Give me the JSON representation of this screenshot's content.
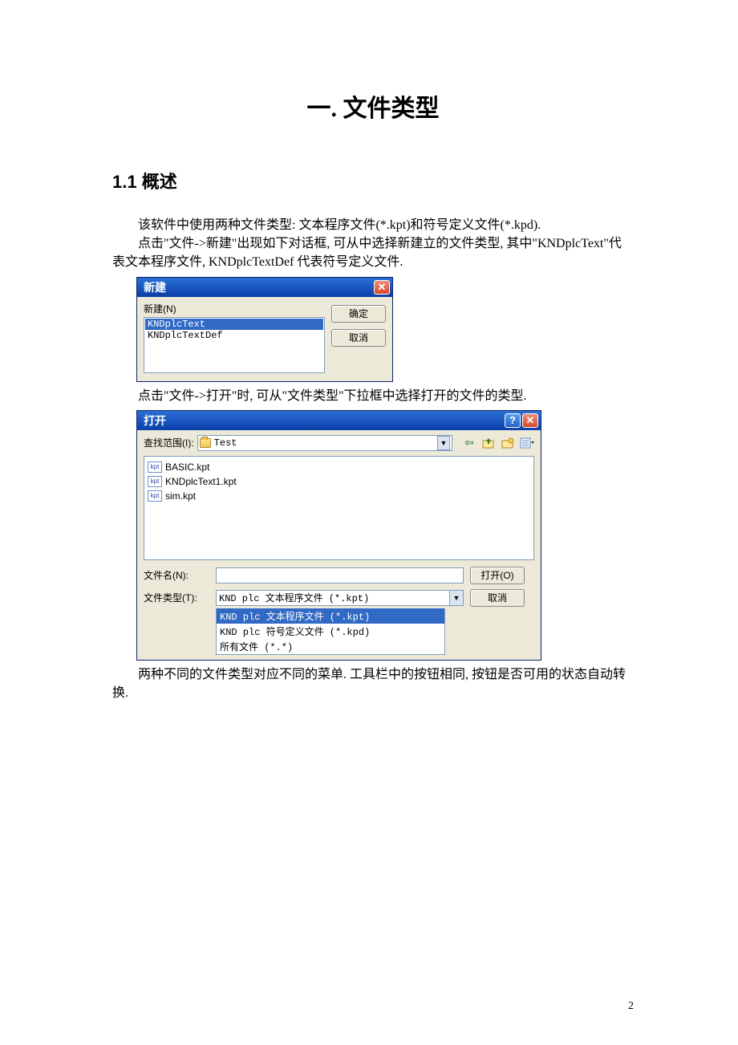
{
  "chapter_title": "一. 文件类型",
  "section_title": "1.1  概述",
  "para1": "该软件中使用两种文件类型: 文本程序文件(*.kpt)和符号定义文件(*.kpd).",
  "para2a": "点击\"文件->新建\"出现如下对话框, 可从中选择新建立的文件类型, 其中\"KNDplcText\"代",
  "para2b": "表文本程序文件, KNDplcTextDef 代表符号定义文件.",
  "para3": "点击\"文件->打开\"时, 可从\"文件类型\"下拉框中选择打开的文件的类型.",
  "para4a": "两种不同的文件类型对应不同的菜单. 工具栏中的按钮相同, 按钮是否可用的状态自动转",
  "para4b": "换.",
  "page_number": "2",
  "dlg_new": {
    "title": "新建",
    "label": "新建(N)",
    "items": [
      "KNDplcText",
      "KNDplcTextDef"
    ],
    "selected_index": 0,
    "ok": "确定",
    "cancel": "取消"
  },
  "dlg_open": {
    "title": "打开",
    "lookin_label": "查找范围(I):",
    "lookin_value": "Test",
    "files": [
      "BASIC.kpt",
      "KNDplcText1.kpt",
      "sim.kpt"
    ],
    "filename_label": "文件名(N):",
    "filename_value": "",
    "filetype_label": "文件类型(T):",
    "filetype_value": "KND plc 文本程序文件 (*.kpt)",
    "open_btn": "打开(O)",
    "cancel_btn": "取消",
    "dropdown_options": [
      "KND plc 文本程序文件 (*.kpt)",
      "KND plc 符号定义文件 (*.kpd)",
      "所有文件 (*.*)"
    ],
    "dropdown_selected_index": 0,
    "file_icon_label": "kpt"
  }
}
